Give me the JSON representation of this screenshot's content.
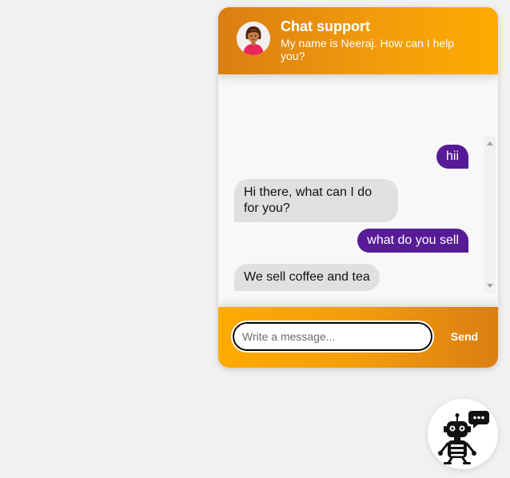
{
  "header": {
    "title": "Chat support",
    "subtitle": "My name is Neeraj. How can I help you?",
    "avatar_icon": "support-agent-avatar"
  },
  "messages": [
    {
      "sender": "user",
      "text": "hii"
    },
    {
      "sender": "bot",
      "text": "Hi there, what can I do for you?"
    },
    {
      "sender": "user",
      "text": "what do you sell"
    },
    {
      "sender": "bot",
      "text": "We sell coffee and tea"
    }
  ],
  "footer": {
    "input_placeholder": "Write a message...",
    "input_value": "",
    "send_label": "Send"
  },
  "launcher": {
    "icon": "robot-chat-icon"
  },
  "colors": {
    "header_gradient_start": "#da7e12",
    "header_gradient_end": "#ffab00",
    "user_bubble": "#581b98",
    "bot_bubble": "#e0e0e0",
    "page_background": "#f1f1f1"
  }
}
